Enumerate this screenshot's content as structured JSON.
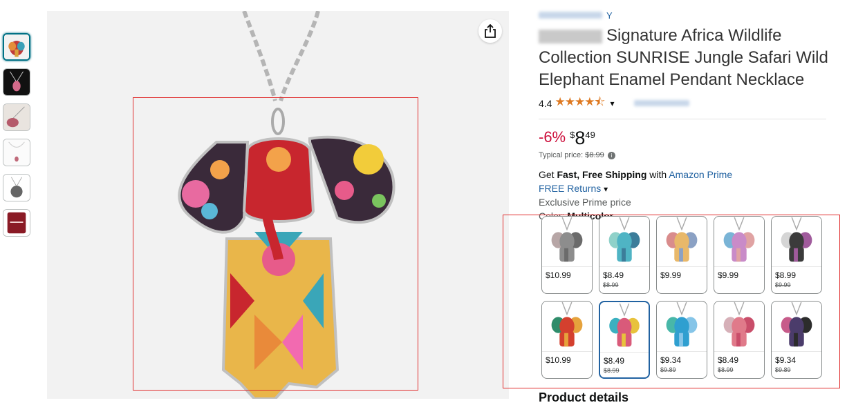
{
  "brand_link_suffix": "Y",
  "title": "Signature Africa Wildlife Collection SUNRISE Jungle Safari Wild Elephant Enamel Pendant Necklace",
  "rating": {
    "value": "4.4",
    "stars": "★★★★⯪",
    "stars_value": 4.4
  },
  "price": {
    "discount": "-6%",
    "symbol": "$",
    "whole": "8",
    "fraction": "49"
  },
  "typical_price": {
    "label": "Typical price:",
    "value": "$8.99"
  },
  "shipping": {
    "prefix": "Get",
    "bold": "Fast, Free Shipping",
    "middle": "with",
    "link": "Amazon Prime"
  },
  "returns": "FREE Returns",
  "exclusive": "Exclusive Prime price",
  "color": {
    "label": "Color:",
    "value": "Multicolor"
  },
  "swatches": [
    {
      "price": "$10.99",
      "old": "",
      "palette": [
        "#8d8d8d",
        "#b7a6a6",
        "#6b6b6b"
      ]
    },
    {
      "price": "$8.49",
      "old": "$8.99",
      "palette": [
        "#4fb4c4",
        "#8fd1c9",
        "#3c7d9a"
      ]
    },
    {
      "price": "$9.99",
      "old": "",
      "palette": [
        "#e8b86a",
        "#d98c8c",
        "#8ba1c4"
      ]
    },
    {
      "price": "$9.99",
      "old": "",
      "palette": [
        "#c98bc8",
        "#7ab4d6",
        "#e0a3a3"
      ]
    },
    {
      "price": "$8.99",
      "old": "$9.99",
      "palette": [
        "#3b3b3b",
        "#d5d5d5",
        "#a05b9c"
      ]
    },
    {
      "price": "$10.99",
      "old": "",
      "palette": [
        "#d4402e",
        "#2f8c6a",
        "#e6a23c"
      ]
    },
    {
      "price": "$8.49",
      "old": "$8.99",
      "palette": [
        "#d95a7a",
        "#3bb0c0",
        "#e8c23c"
      ]
    },
    {
      "price": "$9.34",
      "old": "$9.89",
      "palette": [
        "#2f9fd0",
        "#48b7a8",
        "#86c5e8"
      ]
    },
    {
      "price": "$8.49",
      "old": "$8.99",
      "palette": [
        "#e07a8a",
        "#d6b0b8",
        "#c94e6a"
      ]
    },
    {
      "price": "$9.34",
      "old": "$9.89",
      "palette": [
        "#4b3c6b",
        "#c75b8a",
        "#2c2c2c"
      ]
    }
  ],
  "product_details": "Product details",
  "colors": {
    "accent_link": "#2162a1",
    "discount": "#cc0c39",
    "star": "#de7921",
    "selected": "#2162a1"
  },
  "icons": {
    "share": "share-icon",
    "chevron": "chevron-down-icon",
    "info": "info-icon"
  }
}
